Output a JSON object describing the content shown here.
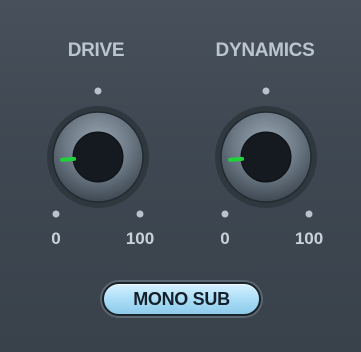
{
  "drive": {
    "label": "DRIVE",
    "min_label": "0",
    "max_label": "100",
    "value": 15
  },
  "dynamics": {
    "label": "DYNAMICS",
    "min_label": "0",
    "max_label": "100",
    "value": 15
  },
  "mono_sub": {
    "label": "MONO SUB",
    "active": true
  },
  "colors": {
    "indicator": "#1ed43a",
    "button_active": "#a8dcf6",
    "label": "#b9c5d0"
  }
}
